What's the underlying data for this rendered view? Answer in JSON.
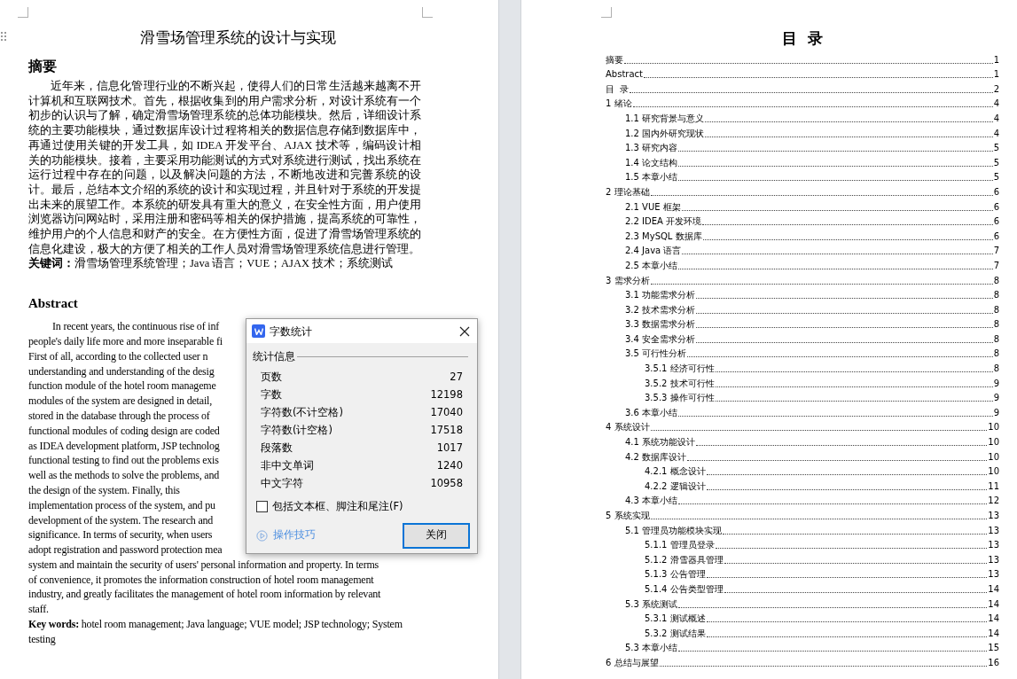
{
  "left_page": {
    "title": "滑雪场管理系统的设计与实现",
    "abstract_cn": {
      "heading": "摘要",
      "body": "近年来，信息化管理行业的不断兴起，使得人们的日常生活越来越离不开计算机和互联网技术。首先，根据收集到的用户需求分析，对设计系统有一个初步的认识与了解，确定滑雪场管理系统的总体功能模块。然后，详细设计系统的主要功能模块，通过数据库设计过程将相关的数据信息存储到数据库中，再通过使用关键的开发工具，如 IDEA 开发平台、AJAX 技术等，编码设计相关的功能模块。接着，主要采用功能测试的方式对系统进行测试，找出系统在运行过程中存在的问题，以及解决问题的方法，不断地改进和完善系统的设计。最后，总结本文介绍的系统的设计和实现过程，并且针对于系统的开发提出未来的展望工作。本系统的研发具有重大的意义，在安全性方面，用户使用浏览器访问网站时，采用注册和密码等相关的保护措施，提高系统的可靠性，维护用户的个人信息和财产的安全。在方便性方面，促进了滑雪场管理系统的信息化建设，极大的方便了相关的工作人员对滑雪场管理系统信息进行管理。",
      "keywords": "**关键词：**滑雪场管理系统管理；Java 语言；VUE；AJAX 技术；系统测试"
    },
    "abstract_en": {
      "heading": "Abstract",
      "lines": [
        "In recent years, the continuous rise of inf",
        "people's daily life more and more inseparable fi",
        "First of all, according to the collected user n",
        "understanding and understanding of the desig",
        "function module of the hotel room manageme",
        "modules of the system are designed in detail,",
        "stored in the database through the process of",
        "functional modules of coding design are coded",
        "as IDEA development platform, JSP technolog",
        "functional testing to find out the problems exis",
        "well as the methods to solve the problems, and",
        "the design of the system. Finally, this",
        "implementation process of the system, and pu",
        "development of the system. The research and",
        "significance. In terms of security, when users",
        "adopt registration and password protection mea",
        "system and maintain the security of users' personal information and property. In terms",
        "of convenience, it promotes the information construction of hotel room management",
        "industry, and greatly facilitates the management of hotel room information by relevant",
        "staff."
      ],
      "keywords": "**Key words:** hotel room management; Java language; VUE model; JSP technology; System testing"
    }
  },
  "dialog": {
    "title": "字数统计",
    "group": "统计信息",
    "stats": [
      {
        "label": "页数",
        "value": "27"
      },
      {
        "label": "字数",
        "value": "12198"
      },
      {
        "label": "字符数(不计空格)",
        "value": "17040"
      },
      {
        "label": "字符数(计空格)",
        "value": "17518"
      },
      {
        "label": "段落数",
        "value": "1017"
      },
      {
        "label": "非中文单词",
        "value": "1240"
      },
      {
        "label": "中文字符",
        "value": "10958"
      }
    ],
    "checkbox": {
      "label": "包括文本框、脚注和尾注(F)",
      "checked": false
    },
    "tips_link": "操作技巧",
    "close_button": "关闭"
  },
  "toc": {
    "title": "目  录",
    "entries": [
      {
        "label": "摘要",
        "page": "1"
      },
      {
        "label": "Abstract",
        "page": "1"
      },
      {
        "label": "目  录",
        "page": "2"
      },
      {
        "label": "1 绪论",
        "page": "4",
        "children": [
          {
            "label": "1.1 研究背景与意义",
            "page": "4"
          },
          {
            "label": "1.2 国内外研究现状",
            "page": "4"
          },
          {
            "label": "1.3 研究内容",
            "page": "5"
          },
          {
            "label": "1.4 论文结构",
            "page": "5"
          },
          {
            "label": "1.5 本章小结",
            "page": "5"
          }
        ]
      },
      {
        "label": "2 理论基础",
        "page": "6",
        "children": [
          {
            "label": "2.1 VUE 框架",
            "page": "6"
          },
          {
            "label": "2.2 IDEA 开发环境",
            "page": "6"
          },
          {
            "label": "2.3 MySQL 数据库",
            "page": "6"
          },
          {
            "label": "2.4 Java 语言",
            "page": "7"
          },
          {
            "label": "2.5 本章小结",
            "page": "7"
          }
        ]
      },
      {
        "label": "3 需求分析",
        "page": "8",
        "children": [
          {
            "label": "3.1 功能需求分析",
            "page": "8"
          },
          {
            "label": "3.2 技术需求分析",
            "page": "8"
          },
          {
            "label": "3.3 数据需求分析",
            "page": "8"
          },
          {
            "label": "3.4 安全需求分析",
            "page": "8"
          },
          {
            "label": "3.5 可行性分析",
            "page": "8",
            "children": [
              {
                "label": "3.5.1 经济可行性",
                "page": "8"
              },
              {
                "label": "3.5.2 技术可行性",
                "page": "9"
              },
              {
                "label": "3.5.3 操作可行性",
                "page": "9"
              }
            ]
          },
          {
            "label": "3.6 本章小结",
            "page": "9"
          }
        ]
      },
      {
        "label": "4 系统设计",
        "page": "10",
        "children": [
          {
            "label": "4.1 系统功能设计",
            "page": "10"
          },
          {
            "label": "4.2 数据库设计",
            "page": "10",
            "children": [
              {
                "label": "4.2.1 概念设计",
                "page": "10"
              },
              {
                "label": "4.2.2 逻辑设计",
                "page": "11"
              }
            ]
          },
          {
            "label": "4.3 本章小结",
            "page": "12"
          }
        ]
      },
      {
        "label": "5 系统实现",
        "page": "13",
        "children": [
          {
            "label": "5.1 管理员功能模块实现",
            "page": "13",
            "children": [
              {
                "label": "5.1.1 管理员登录",
                "page": "13"
              },
              {
                "label": "5.1.2 滑雪器具管理",
                "page": "13"
              },
              {
                "label": "5.1.3 公告管理",
                "page": "13"
              },
              {
                "label": "5.1.4 公告类型管理",
                "page": "14"
              }
            ]
          },
          {
            "label": "5.3 系统测试",
            "page": "14",
            "children": [
              {
                "label": "5.3.1 测试概述",
                "page": "14"
              },
              {
                "label": "5.3.2 测试结果",
                "page": "14"
              }
            ]
          },
          {
            "label": "5.3 本章小结",
            "page": "15"
          }
        ]
      },
      {
        "label": "6 总结与展望",
        "page": "16"
      }
    ]
  }
}
